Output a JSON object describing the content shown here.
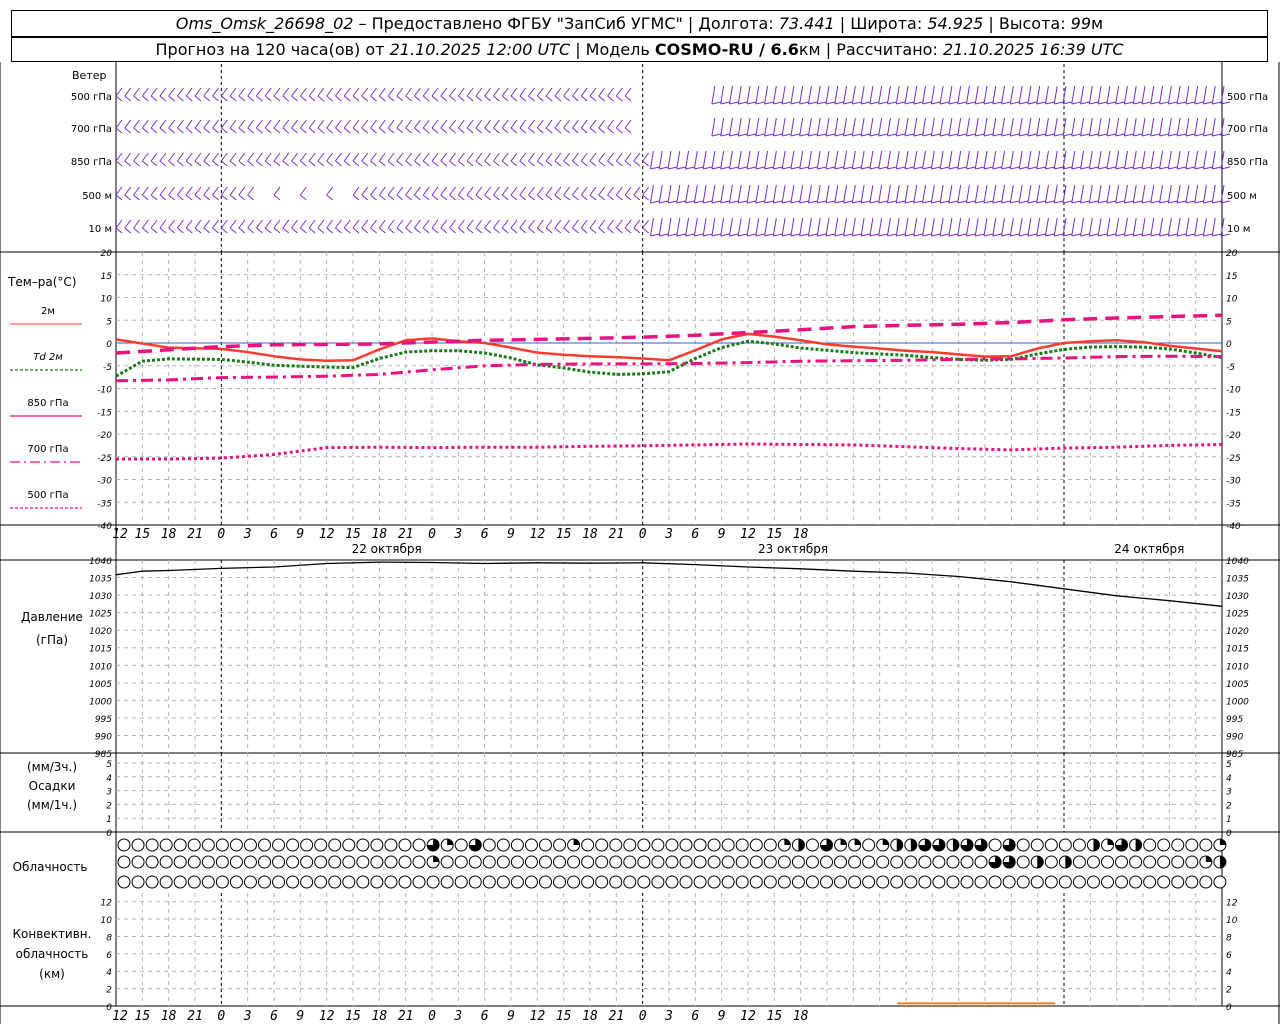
{
  "header": {
    "station": "Oms_Omsk_26698_02",
    "provided": " – Предоставлено ФГБУ \"ЗапСиб УГМС\" | Долгота: ",
    "lon": "73.441",
    "lat_label": " | Широта: ",
    "lat": "54.925",
    "alt_label": " | Высота: ",
    "alt": "99",
    "alt_unit": "м",
    "forecast_prefix": "Прогноз на 120 часа(ов) от ",
    "init_time": "21.10.2025 12:00 UTC",
    "model_label": "  | Модель ",
    "model": "COSMO-RU / 6.6",
    "model_unit": "км",
    "calc_label": " | Рассчитано: ",
    "calc_time": "21.10.2025 16:39 UTC"
  },
  "colors": {
    "wind": "#7b2ccf",
    "t2m": "#ff3b30",
    "td2m": "#1a7a1a",
    "t850": "#e8137e",
    "t700": "#e8137e",
    "t500": "#e8137e",
    "pressure": "#000000",
    "grid": "#b4b4b4",
    "conv": "#f08020"
  },
  "wind_panel": {
    "title": "Ветер",
    "levels": [
      "500 гПа",
      "700 гПа",
      "850 гПа",
      "500 м",
      "10 м"
    ]
  },
  "temp_panel": {
    "label": "Тем–ра(°С)",
    "legend": [
      {
        "label": "2м",
        "style": "solid"
      },
      {
        "label": "Td 2м",
        "style": "dotted"
      },
      {
        "label": "850 гПа",
        "style": "solid"
      },
      {
        "label": "700 гПа",
        "style": "dashdot"
      },
      {
        "label": "500 гПа",
        "style": "dotted"
      }
    ],
    "yticks": [
      20,
      15,
      10,
      5,
      0,
      -5,
      -10,
      -15,
      -20,
      -25,
      -30,
      -35,
      -40
    ]
  },
  "pressure_panel": {
    "label1": "Давление",
    "label2": "(гПа)",
    "yticks": [
      1040,
      1035,
      1030,
      1025,
      1020,
      1015,
      1010,
      1005,
      1000,
      995,
      990,
      985
    ]
  },
  "precip_panel": {
    "label1": "(мм/3ч.)",
    "label2": "Осадки",
    "label3": "(мм/1ч.)",
    "yticks": [
      5,
      4,
      3,
      2,
      1,
      0
    ]
  },
  "cloud_panel": {
    "label": "Облачность",
    "rows": [
      "000000000000000000000042640000002000000000000002304220233443440400000324300000200000000000000000000044244424422434414",
      "000000000000000000000020000000000000000000000000000000000000004403030000000002302000200000000000000000000020220000004",
      "000000000000000000000000000000000000000000000000000000000000000000000000000000000000000000000000000000000000000000000"
    ]
  },
  "conv_panel": {
    "label1": "Конвективн.",
    "label2": "облачность",
    "label3": "(км)",
    "yticks": [
      12,
      10,
      8,
      6,
      4,
      2,
      0
    ],
    "segment": {
      "x_start": 89,
      "x_end": 107,
      "value": 0.3
    }
  },
  "time_axis": {
    "hour_labels": [
      "12",
      "15",
      "18",
      "21",
      "0",
      "3",
      "6",
      "9",
      "12",
      "15",
      "18",
      "21",
      "0",
      "3",
      "6",
      "9",
      "12",
      "15",
      "18",
      "21",
      "0",
      "3",
      "6",
      "9",
      "12",
      "15",
      "18"
    ],
    "date_labels": [
      "22 октября",
      "23 октября",
      "24 октября"
    ]
  },
  "chart_data": [
    {
      "type": "wind",
      "title": "Ветер",
      "levels": [
        "500 гПа",
        "700 гПа",
        "850 гПа",
        "500 м",
        "10 м"
      ],
      "note": "Wind barbs at each forecast hour, 5 levels"
    },
    {
      "type": "line",
      "title": "Тем–ра(°С)",
      "x_unit": "hours from 21.10.2025 12:00 UTC",
      "ylim": [
        -40,
        20
      ],
      "series": [
        {
          "name": "2м",
          "x": [
            0,
            6,
            12,
            15,
            18,
            21,
            24,
            27,
            30,
            33,
            36,
            39,
            42,
            45,
            48,
            51,
            54,
            57,
            60,
            63,
            66,
            69,
            72,
            75,
            78,
            81,
            84,
            87,
            90,
            93,
            96,
            99,
            102,
            105,
            108,
            111,
            114,
            117,
            120,
            123,
            126
          ],
          "values": [
            0.8,
            -1.0,
            -1.3,
            -2.0,
            -2.9,
            -3.6,
            -3.9,
            -3.8,
            -1.4,
            0.6,
            1.0,
            0.4,
            0.0,
            -1.0,
            -2.1,
            -2.6,
            -2.9,
            -3.1,
            -3.4,
            -3.8,
            -1.6,
            0.8,
            2.0,
            1.4,
            0.6,
            -0.3,
            -0.8,
            -1.2,
            -1.7,
            -2.0,
            -2.5,
            -3.0,
            -2.9,
            -1.2,
            0.0,
            0.4,
            0.6,
            0.2,
            -0.6,
            -1.2,
            -1.8
          ]
        },
        {
          "name": "Td 2м",
          "x": [
            0,
            3,
            6,
            12,
            15,
            18,
            21,
            24,
            27,
            30,
            33,
            36,
            39,
            42,
            45,
            48,
            51,
            54,
            57,
            60,
            63,
            66,
            69,
            72,
            75,
            78,
            81,
            84,
            87,
            90,
            93,
            96,
            99,
            102,
            105,
            108,
            111,
            114,
            117,
            120,
            123,
            126
          ],
          "values": [
            -7.3,
            -4.0,
            -3.5,
            -3.6,
            -4.2,
            -4.9,
            -5.1,
            -5.3,
            -5.4,
            -3.4,
            -2.0,
            -1.7,
            -1.7,
            -2.2,
            -3.3,
            -4.8,
            -5.5,
            -6.4,
            -6.9,
            -6.8,
            -6.3,
            -3.4,
            -1.0,
            0.4,
            -0.2,
            -1.1,
            -1.6,
            -2.1,
            -2.4,
            -2.7,
            -3.2,
            -3.6,
            -3.8,
            -3.6,
            -2.4,
            -1.4,
            -0.9,
            -0.8,
            -0.9,
            -1.3,
            -2.2,
            -3.2
          ]
        },
        {
          "name": "850 гПа",
          "x": [
            0,
            6,
            12,
            18,
            24,
            30,
            36,
            42,
            48,
            54,
            60,
            66,
            72,
            78,
            84,
            90,
            96,
            102,
            108,
            114,
            120,
            126
          ],
          "values": [
            -2.2,
            -1.5,
            -0.8,
            -0.4,
            -0.3,
            -0.2,
            0.2,
            0.6,
            0.8,
            1.0,
            1.3,
            1.7,
            2.3,
            2.9,
            3.6,
            3.9,
            4.1,
            4.5,
            5.1,
            5.5,
            5.8,
            6.1
          ]
        },
        {
          "name": "700 гПа",
          "x": [
            0,
            6,
            12,
            18,
            24,
            30,
            36,
            42,
            48,
            54,
            60,
            66,
            72,
            78,
            84,
            90,
            96,
            102,
            108,
            114,
            120,
            126
          ],
          "values": [
            -8.3,
            -8.1,
            -7.6,
            -7.5,
            -7.3,
            -6.9,
            -5.9,
            -5.0,
            -4.7,
            -4.6,
            -4.6,
            -4.5,
            -4.3,
            -4.0,
            -3.9,
            -3.8,
            -3.6,
            -3.5,
            -3.3,
            -3.0,
            -2.9,
            -3.0
          ]
        },
        {
          "name": "500 гПа",
          "x": [
            0,
            6,
            12,
            18,
            24,
            30,
            36,
            42,
            48,
            54,
            60,
            66,
            72,
            78,
            84,
            90,
            96,
            102,
            108,
            114,
            120,
            126
          ],
          "values": [
            -25.5,
            -25.5,
            -25.3,
            -24.5,
            -23.0,
            -22.9,
            -23.0,
            -22.9,
            -22.9,
            -22.7,
            -22.6,
            -22.4,
            -22.2,
            -22.3,
            -22.4,
            -22.8,
            -23.2,
            -23.5,
            -23.1,
            -22.9,
            -22.5,
            -22.3
          ]
        }
      ]
    },
    {
      "type": "line",
      "title": "Давление",
      "ylabel": "(гПа)",
      "ylim": [
        985,
        1040
      ],
      "series": [
        {
          "name": "Давление",
          "x": [
            0,
            3,
            6,
            12,
            18,
            24,
            30,
            36,
            42,
            48,
            54,
            60,
            66,
            72,
            78,
            84,
            90,
            96,
            102,
            108,
            114,
            120,
            126
          ],
          "values": [
            1035.8,
            1036.8,
            1037.0,
            1037.6,
            1038.0,
            1039.0,
            1039.4,
            1039.3,
            1039.0,
            1039.2,
            1039.1,
            1039.2,
            1038.7,
            1038.0,
            1037.5,
            1036.8,
            1036.3,
            1035.3,
            1033.8,
            1031.8,
            1029.8,
            1028.4,
            1026.8
          ]
        }
      ]
    },
    {
      "type": "bar",
      "title": "Осадки",
      "ylim": [
        0,
        5
      ],
      "values": []
    },
    {
      "type": "bar",
      "title": "Конвективн. облачность",
      "ylabel": "(км)",
      "ylim": [
        0,
        13
      ],
      "segment": {
        "x_start": 89,
        "x_end": 107,
        "value": 0.3
      }
    }
  ]
}
